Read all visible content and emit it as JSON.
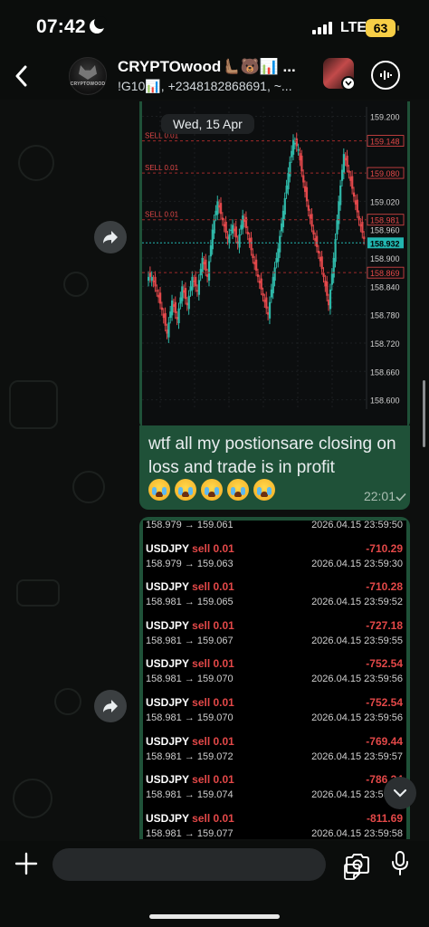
{
  "status_bar": {
    "time": "07:42",
    "network": "LTE",
    "battery": "63"
  },
  "header": {
    "title": "CRYPTOwood🫷🏽🐻📊 ...",
    "subtitle": "!G10📊, +2348182868691, ~...",
    "avatar_text": "CRYPTOWOOD"
  },
  "date_pill": "Wed, 15 Apr",
  "chart_data": {
    "type": "line",
    "title": "",
    "ylim": [
      158.58,
      159.22
    ],
    "y_ticks": [
      "159.200",
      "159.148",
      "159.080",
      "159.020",
      "158.981",
      "158.960",
      "158.932",
      "158.900",
      "158.869",
      "158.840",
      "158.780",
      "158.720",
      "158.660",
      "158.600"
    ],
    "levels": [
      {
        "label": "SELL 0.01",
        "value": 159.148,
        "tag": "159.148"
      },
      {
        "label": "SELL 0.01",
        "value": 159.08,
        "tag": "159.080"
      },
      {
        "label": "SELL 0.01",
        "value": 158.981,
        "tag": "158.981"
      },
      {
        "label": "",
        "value": 158.869,
        "tag": "158.869"
      }
    ],
    "current_price": {
      "value": 158.932,
      "tag": "158.932"
    },
    "series": [
      {
        "values": [
          158.86,
          158.83,
          158.79,
          158.74,
          158.81,
          158.77,
          158.84,
          158.8,
          158.86,
          158.83,
          158.9,
          158.86,
          158.96,
          159.02,
          158.98,
          158.94,
          158.97,
          158.93,
          158.99,
          158.95,
          158.9,
          158.86,
          158.82,
          158.78,
          158.86,
          158.92,
          159.0,
          159.08,
          159.15,
          159.13,
          159.06,
          159.0,
          158.95,
          158.91,
          158.86,
          158.8,
          158.9,
          159.02,
          159.12,
          159.08,
          159.03,
          158.98,
          158.94
        ]
      }
    ]
  },
  "messages": {
    "text": "wtf all my postionsare closing on loss and trade is in profit",
    "emoji_count": 5,
    "time": "22:01"
  },
  "trades": [
    {
      "symbol": "USDJPY",
      "side": "sell 0.01",
      "prices": "158.979 → 159.061",
      "pl": "-710.15",
      "ts": "2026.04.15 23:59:50"
    },
    {
      "symbol": "USDJPY",
      "side": "sell 0.01",
      "prices": "158.979 → 159.063",
      "pl": "-710.29",
      "ts": "2026.04.15 23:59:30"
    },
    {
      "symbol": "USDJPY",
      "side": "sell 0.01",
      "prices": "158.981 → 159.065",
      "pl": "-710.28",
      "ts": "2026.04.15 23:59:52"
    },
    {
      "symbol": "USDJPY",
      "side": "sell 0.01",
      "prices": "158.981 → 159.067",
      "pl": "-727.18",
      "ts": "2026.04.15 23:59:55"
    },
    {
      "symbol": "USDJPY",
      "side": "sell 0.01",
      "prices": "158.981 → 159.070",
      "pl": "-752.54",
      "ts": "2026.04.15 23:59:56"
    },
    {
      "symbol": "USDJPY",
      "side": "sell 0.01",
      "prices": "158.981 → 159.070",
      "pl": "-752.54",
      "ts": "2026.04.15 23:59:56"
    },
    {
      "symbol": "USDJPY",
      "side": "sell 0.01",
      "prices": "158.981 → 159.072",
      "pl": "-769.44",
      "ts": "2026.04.15 23:59:57"
    },
    {
      "symbol": "USDJPY",
      "side": "sell 0.01",
      "prices": "158.981 → 159.074",
      "pl": "-786.34",
      "ts": "2026.04.15 23:59:57"
    },
    {
      "symbol": "USDJPY",
      "side": "sell 0.01",
      "prices": "158.981 → 159.077",
      "pl": "-811.69",
      "ts": "2026.04.15 23:59:58"
    }
  ],
  "icons": {
    "back": "chevron-left-icon",
    "call": "audio-call-icon",
    "forward": "forward-icon",
    "plus": "plus-icon",
    "sticker": "sticker-icon",
    "camera": "camera-icon",
    "mic": "mic-icon",
    "scroll": "chevron-down-icon"
  },
  "colors": {
    "outgoing_bubble": "#1f5138",
    "loss_red": "#e34848",
    "bull_candle": "#2fb8a8",
    "bear_candle": "#e3484b",
    "current_price_line": "#22b6b0"
  }
}
